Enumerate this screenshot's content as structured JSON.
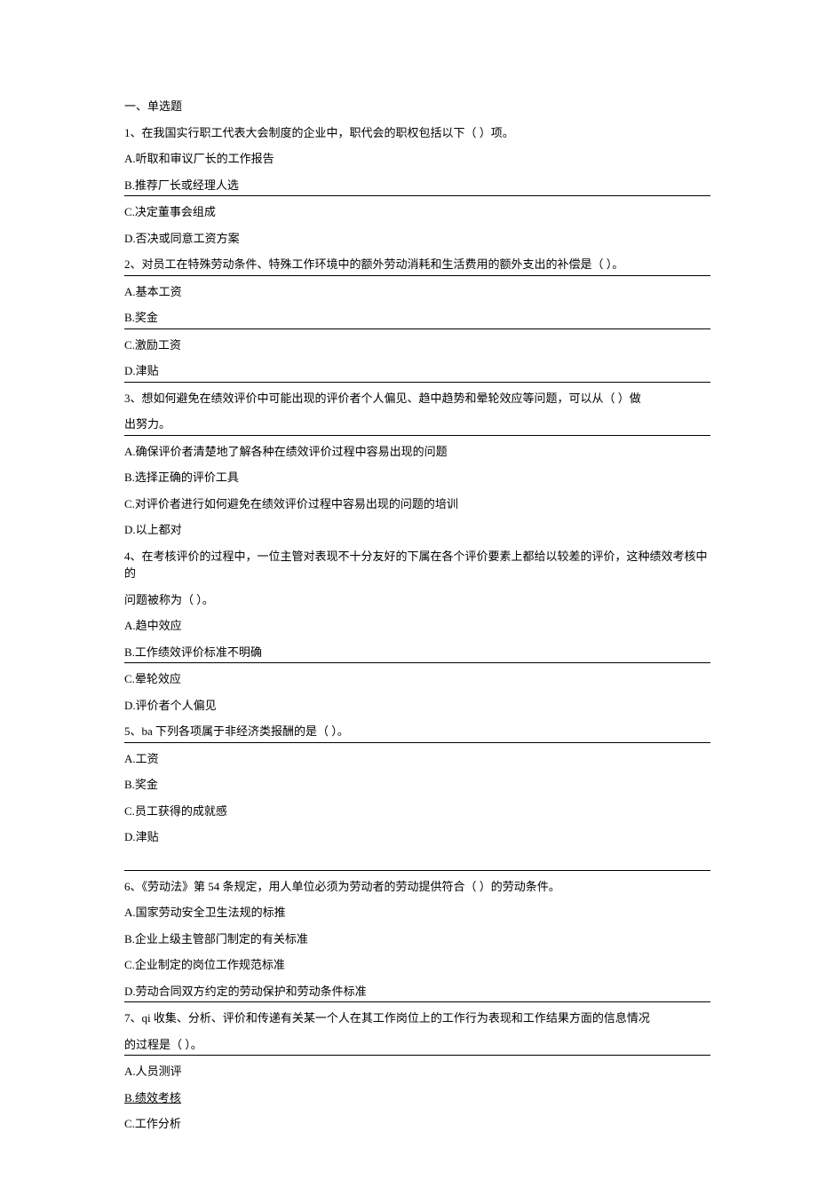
{
  "section_title": "一、单选题",
  "q1": {
    "stem": "1、在我国实行职工代表大会制度的企业中，职代会的职权包括以下（ ）项。",
    "a": "A.听取和审议厂长的工作报告",
    "b": "B.推荐厂长或经理人选",
    "c": "C.决定董事会组成",
    "d": "D.否决或同意工资方案"
  },
  "q2": {
    "stem": "2、对员工在特殊劳动条件、特殊工作环境中的额外劳动消耗和生活费用的额外支出的补偿是（ ）。",
    "a": "A.基本工资",
    "b": "B.奖金",
    "c": "C.激励工资",
    "d": "D.津贴"
  },
  "q3": {
    "stem_line1": "3、想如何避免在绩效评价中可能出现的评价者个人偏见、趋中趋势和晕轮效应等问题，可以从（ ）做",
    "stem_line2": "出努力。",
    "a": "A.确保评价者清楚地了解各种在绩效评价过程中容易出现的问题",
    "b": "B.选择正确的评价工具",
    "c": "C.对评价者进行如何避免在绩效评价过程中容易出现的问题的培训",
    "d": "D.以上都对"
  },
  "q4": {
    "stem_line1": "4、在考核评价的过程中，一位主管对表现不十分友好的下属在各个评价要素上都给以较差的评价，这种绩效考核中的",
    "stem_line2": "问题被称为（ ）。",
    "a": "A.趋中效应",
    "b": "B.工作绩效评价标准不明确",
    "c": "C.晕轮效应",
    "d": "D.评价者个人偏见"
  },
  "q5": {
    "stem": "5、ba 下列各项属于非经济类报酬的是（ ）。",
    "a": "A.工资",
    "b": "B.奖金",
    "c": "C.员工获得的成就感",
    "d": "D.津贴"
  },
  "q6": {
    "stem": "6、《劳动法》第 54 条规定，用人单位必须为劳动者的劳动提供符合（ ）的劳动条件。",
    "a": "A.国家劳动安全卫生法规的标推",
    "b": "B.企业上级主管部门制定的有关标准",
    "c": "C.企业制定的岗位工作规范标准",
    "d": "D.劳动合同双方约定的劳动保护和劳动条件标准"
  },
  "q7": {
    "stem_line1": "7、qi 收集、分析、评价和传递有关某一个人在其工作岗位上的工作行为表现和工作结果方面的信息情况",
    "stem_line2": "的过程是（ ）。",
    "a": "A.人员测评",
    "b": "B.绩效考核",
    "c": "C.工作分析"
  }
}
